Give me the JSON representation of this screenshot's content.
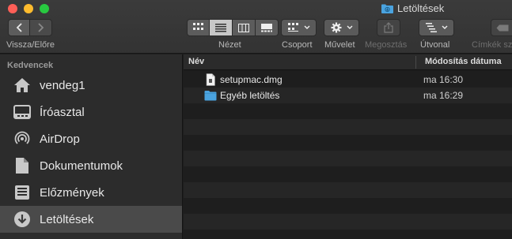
{
  "window": {
    "title": "Letöltések"
  },
  "toolbar": {
    "nav_label": "Vissza/Előre",
    "view_label": "Nézet",
    "group_label": "Csoport",
    "action_label": "Művelet",
    "share_label": "Megosztás",
    "path_label": "Útvonal",
    "tags_label": "Címkék szer"
  },
  "sidebar": {
    "heading": "Kedvencek",
    "items": [
      {
        "label": "vendeg1",
        "icon": "home-icon"
      },
      {
        "label": "Íróasztal",
        "icon": "desktop-icon"
      },
      {
        "label": "AirDrop",
        "icon": "airdrop-icon"
      },
      {
        "label": "Dokumentumok",
        "icon": "documents-icon"
      },
      {
        "label": "Előzmények",
        "icon": "recents-icon"
      },
      {
        "label": "Letöltések",
        "icon": "downloads-icon",
        "selected": true
      }
    ]
  },
  "list": {
    "columns": {
      "name": "Név",
      "date": "Módosítás dátuma"
    },
    "rows": [
      {
        "name": "setupmac.dmg",
        "date": "ma 16:30",
        "icon": "dmg-file-icon"
      },
      {
        "name": "Egyéb letöltés",
        "date": "ma 16:29",
        "icon": "folder-icon"
      }
    ]
  },
  "colors": {
    "folder_blue": "#4aa3df",
    "selection": "#4a4a4a"
  }
}
